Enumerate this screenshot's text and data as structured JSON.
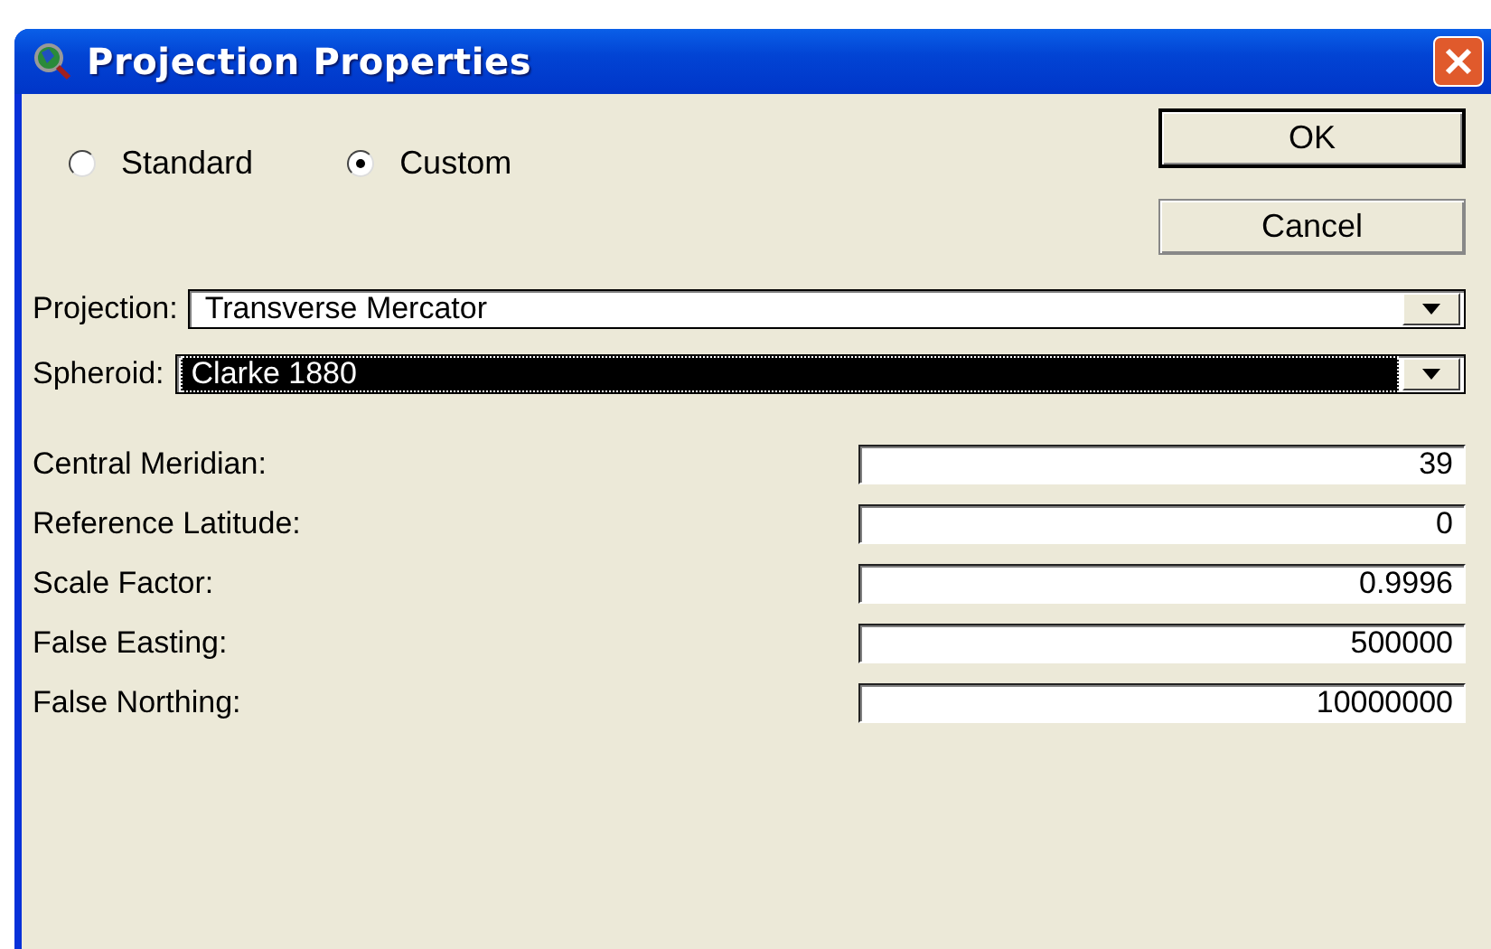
{
  "window": {
    "title": "Projection Properties"
  },
  "mode": [
    {
      "label": "Standard",
      "selected": false
    },
    {
      "label": "Custom",
      "selected": true
    }
  ],
  "buttons": [
    {
      "label": "OK",
      "default": true
    },
    {
      "label": "Cancel",
      "default": false
    }
  ],
  "dropdowns": [
    {
      "label": "Projection:",
      "value": "Transverse Mercator",
      "focused": false
    },
    {
      "label": "Spheroid:",
      "value": "Clarke 1880",
      "focused": true
    }
  ],
  "parameters": [
    {
      "label": "Central Meridian:",
      "value": "39"
    },
    {
      "label": "Reference Latitude:",
      "value": "0"
    },
    {
      "label": "Scale Factor:",
      "value": "0.9996"
    },
    {
      "label": "False Easting:",
      "value": "500000"
    },
    {
      "label": "False Northing:",
      "value": "10000000"
    }
  ]
}
